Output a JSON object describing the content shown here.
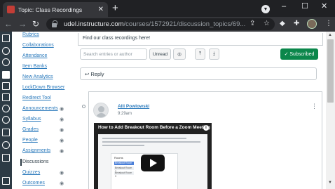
{
  "browser": {
    "tab_title": "Topic: Class Recordings",
    "tab_close": "✕",
    "new_tab": "+",
    "url_host": "udel.instructure.com",
    "url_path": "/courses/1572921/discussion_topics/69...",
    "window_controls": [
      "–",
      "☐",
      "✕"
    ],
    "toolbar_icons": [
      "share-icon",
      "star-icon",
      "extensions-icon",
      "puzzle-icon",
      "profile-avatar",
      "menu-icon"
    ]
  },
  "course_nav": {
    "items": [
      {
        "label": "Rubrics",
        "hidden": false
      },
      {
        "label": "Collaborations",
        "hidden": false
      },
      {
        "label": "Attendance",
        "hidden": false
      },
      {
        "label": "Item Banks",
        "hidden": false
      },
      {
        "label": "New Analytics",
        "hidden": false
      },
      {
        "label": "LockDown Browser",
        "hidden": false
      },
      {
        "label": "Redirect Tool",
        "hidden": false
      },
      {
        "label": "Announcements",
        "hidden": true
      },
      {
        "label": "Syllabus",
        "hidden": true
      },
      {
        "label": "Grades",
        "hidden": true
      },
      {
        "label": "People",
        "hidden": true
      },
      {
        "label": "Assignments",
        "hidden": true
      },
      {
        "label": "Discussions",
        "hidden": false,
        "active": true
      },
      {
        "label": "Quizzes",
        "hidden": true
      },
      {
        "label": "Outcomes",
        "hidden": true
      }
    ]
  },
  "topic": {
    "message": "Find our class recordings here!",
    "search_placeholder": "Search entries or author",
    "unread_label": "Unread",
    "subscribed_label": "✓ Subscribed",
    "reply_label": "Reply"
  },
  "entry": {
    "author": "Alli Powlowski",
    "time": "9:29am",
    "video": {
      "title": "How to Add Breakout Room Before a Zoom Meeting",
      "info": "i",
      "rooms_heading": "Rooms",
      "rooms": [
        "Breakout Room 1",
        "Breakout Room 2",
        "Breakout Room 3"
      ]
    }
  },
  "colors": {
    "global_nav": "#2d3b45",
    "link": "#2b7abc",
    "subscribed": "#0b874b"
  }
}
